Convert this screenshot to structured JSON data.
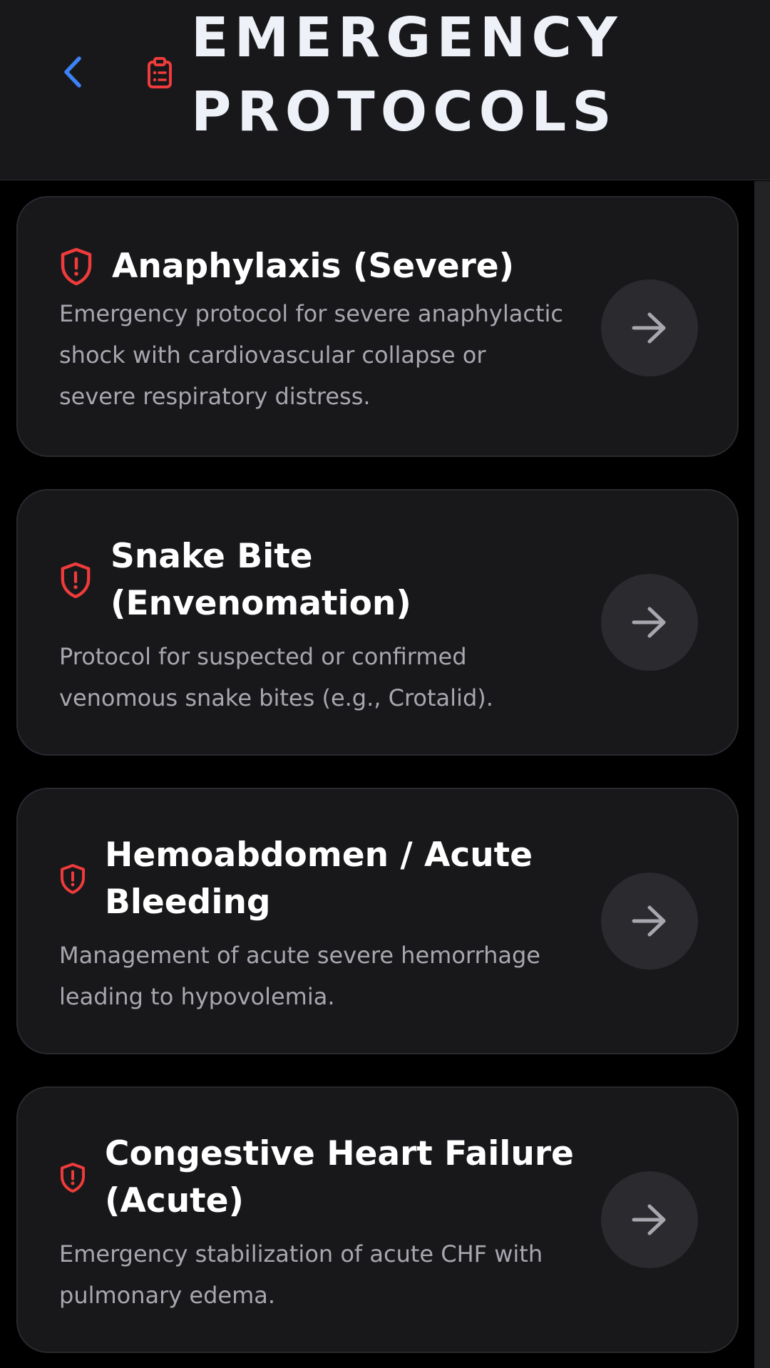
{
  "header": {
    "title": "EMERGENCY\nPROTOCOLS",
    "back_icon": "chevron-left-icon",
    "title_icon": "clipboard-list-icon"
  },
  "colors": {
    "background": "#000000",
    "surface": "#18181b",
    "accent_blue": "#3b82f6",
    "danger_red": "#ef3b3b",
    "title_text": "#eef1f8",
    "desc_text": "#a7a7af",
    "button_bg": "#2b2b2f"
  },
  "protocols": [
    {
      "title": "Anaphylaxis (Severe)",
      "description": "Emergency protocol for severe anaphylactic\nshock with cardiovascular collapse or\nsevere respiratory distress.",
      "icon": "shield-alert-icon",
      "action_icon": "arrow-right-icon"
    },
    {
      "title": "Snake Bite\n(Envenomation)",
      "description": "Protocol for suspected or confirmed\nvenomous snake bites (e.g., Crotalid).",
      "icon": "shield-alert-icon",
      "action_icon": "arrow-right-icon"
    },
    {
      "title": "Hemoabdomen / Acute\nBleeding",
      "description": "Management of acute severe hemorrhage\nleading to hypovolemia.",
      "icon": "shield-alert-icon",
      "action_icon": "arrow-right-icon"
    },
    {
      "title": "Congestive Heart Failure\n(Acute)",
      "description": "Emergency stabilization of acute CHF with\npulmonary edema.",
      "icon": "shield-alert-icon",
      "action_icon": "arrow-right-icon"
    }
  ]
}
